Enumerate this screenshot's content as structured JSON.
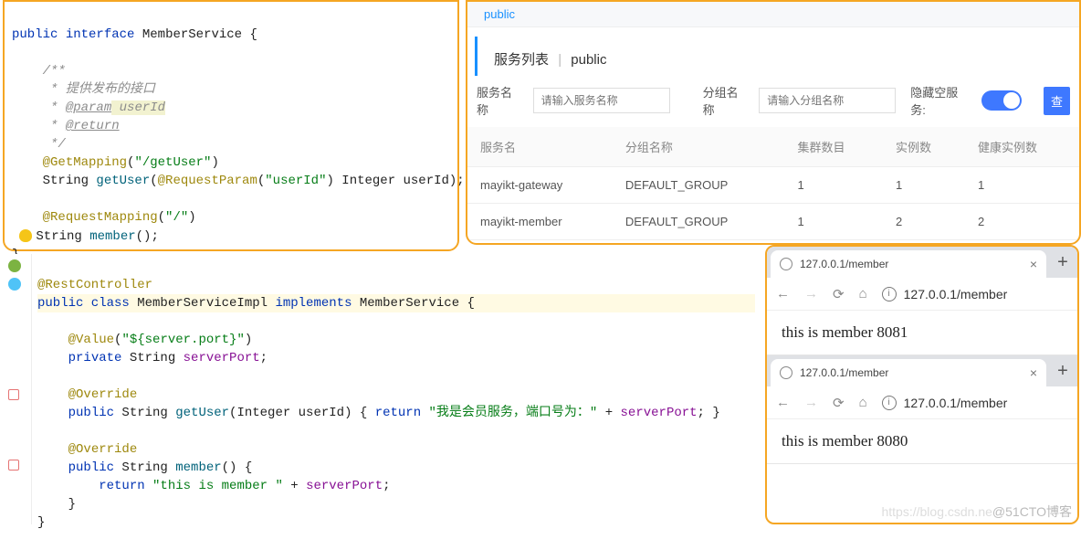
{
  "code_top": {
    "l1a": "public",
    "l1b": "interface",
    "l1c": "MemberService {",
    "l3": "/**",
    "l4": " * 提供发布的接口",
    "l5a": " * ",
    "l5b": "@param",
    "l5c": " userId",
    "l6a": " * ",
    "l6b": "@return",
    "l7": " */",
    "l8a": "@GetMapping",
    "l8b": "(",
    "l8c": "\"/getUser\"",
    "l8d": ")",
    "l9a": "String ",
    "l9b": "getUser",
    "l9c": "(",
    "l9d": "@RequestParam",
    "l9e": "(",
    "l9f": "\"userId\"",
    "l9g": ") Integer userId);",
    "l11a": "@RequestMapping",
    "l11b": "(",
    "l11c": "\"/\"",
    "l11d": ")",
    "l12a": "String ",
    "l12b": "member",
    "l12c": "();",
    "l13": "}"
  },
  "code_bottom": {
    "l1": "@RestController",
    "l2a": "public class ",
    "l2b": "MemberServiceImpl ",
    "l2c": "implements ",
    "l2d": "MemberService {",
    "l4a": "@Value",
    "l4b": "(",
    "l4c": "\"${server.port}\"",
    "l4d": ")",
    "l5a": "private ",
    "l5b": "String ",
    "l5c": "serverPort",
    "l5d": ";",
    "l7": "@Override",
    "l8a": "public ",
    "l8b": "String ",
    "l8c": "getUser",
    "l8d": "(Integer userId) { ",
    "l8e": "return ",
    "l8f": "\"我是会员服务，端口号为：\"",
    "l8g": " + ",
    "l8h": "serverPort",
    "l8i": "; }",
    "l10": "@Override",
    "l11a": "public ",
    "l11b": "String ",
    "l11c": "member",
    "l11d": "() {",
    "l12a": "return ",
    "l12b": "\"this is member \"",
    "l12c": " + ",
    "l12d": "serverPort",
    "l12e": ";",
    "l13": "}",
    "l14": "}"
  },
  "nacos": {
    "tab": "public",
    "crumb1": "服务列表",
    "crumb_sep": "|",
    "crumb2": "public",
    "filter1_label": "服务名称",
    "filter1_placeholder": "请输入服务名称",
    "filter2_label": "分组名称",
    "filter2_placeholder": "请输入分组名称",
    "toggle_label": "隐藏空服务:",
    "search_btn": "查",
    "headers": {
      "c1": "服务名",
      "c2": "分组名称",
      "c3": "集群数目",
      "c4": "实例数",
      "c5": "健康实例数"
    },
    "rows": [
      {
        "c1": "mayikt-gateway",
        "c2": "DEFAULT_GROUP",
        "c3": "1",
        "c4": "1",
        "c5": "1"
      },
      {
        "c1": "mayikt-member",
        "c2": "DEFAULT_GROUP",
        "c3": "1",
        "c4": "2",
        "c5": "2"
      }
    ]
  },
  "browser1": {
    "tab_title": "127.0.0.1/member",
    "url": "127.0.0.1/member",
    "body": "this is member 8081"
  },
  "browser2": {
    "tab_title": "127.0.0.1/member",
    "url": "127.0.0.1/member",
    "body": "this is member 8080"
  },
  "watermark1": "https://blog.csdn.ne",
  "watermark2": "@51CTO博客"
}
